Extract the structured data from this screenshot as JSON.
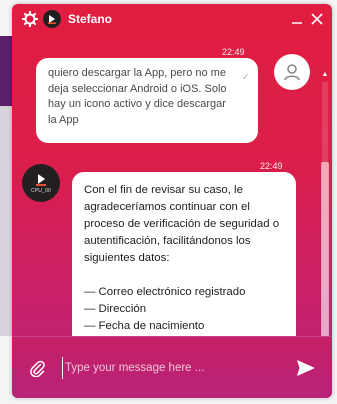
{
  "header": {
    "agent_name": "Stefano",
    "icons": [
      "gear-icon",
      "agent-logo-icon",
      "minimize-icon",
      "close-icon"
    ]
  },
  "messages": [
    {
      "sender": "user",
      "time": "22:49",
      "lines": [
        "quiero descargar la App, pero no me",
        "deja seleccionar Android o iOS. Solo",
        "hay un icono activo y dice descargar",
        "la App"
      ]
    },
    {
      "sender": "agent",
      "time": "22:49",
      "avatar_label": "CPU_00",
      "lines": [
        "Con el fin de revisar su caso, le",
        "agradeceríamos continuar con el",
        "proceso de verificación de seguridad o",
        "autentificación, facilitándonos los",
        "siguientes datos:",
        "",
        "— Correo electrónico registrado",
        "— Dirección",
        "— Fecha de nacimiento"
      ]
    }
  ],
  "composer": {
    "placeholder": "Type your message here ...",
    "value": ""
  },
  "colors": {
    "gradient_top": "#e11d3f",
    "gradient_bottom": "#b8237b",
    "bubble": "#ffffff"
  }
}
